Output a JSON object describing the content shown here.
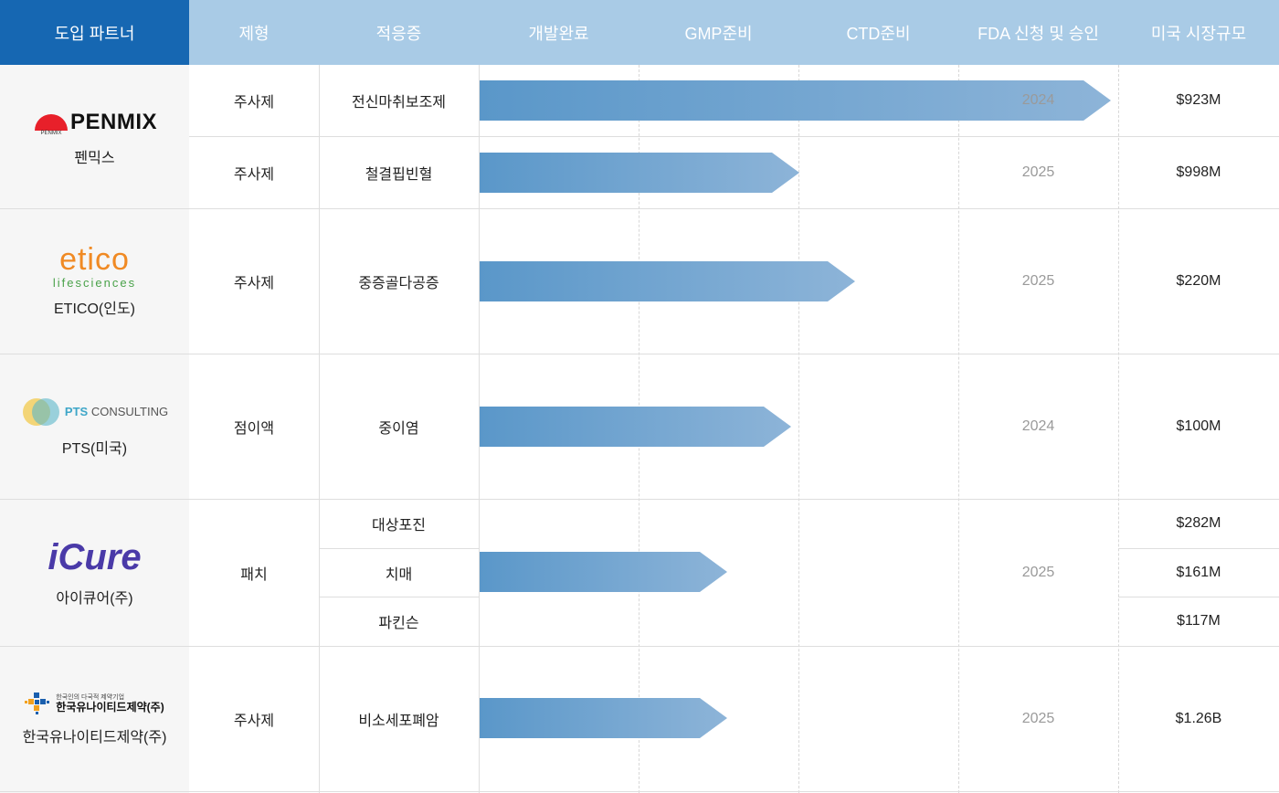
{
  "header": {
    "columns": [
      "도입 파트너",
      "제형",
      "적응증",
      "개발완료",
      "GMP준비",
      "CTD준비",
      "FDA 신청 및 승인",
      "미국 시장규모"
    ]
  },
  "partners": [
    {
      "logo_text": "PENMIX",
      "logo_small": "PENMIX",
      "name": "펜믹스"
    },
    {
      "logo_text": "etico",
      "logo_sub": "lifesciences",
      "name": "ETICO(인도)"
    },
    {
      "logo_text": "PTS",
      "logo_sub": "CONSULTING",
      "name": "PTS(미국)"
    },
    {
      "logo_text": "iCure",
      "name": "아이큐어(주)"
    },
    {
      "logo_small": "한국인의 다국적 제약기업",
      "logo_text": "한국유나이티드제약(주)",
      "name": "한국유나이티드제약(주)"
    }
  ],
  "rows": [
    {
      "form": "주사제",
      "indications": [
        "전신마취보조제"
      ],
      "year": "2024",
      "markets": [
        "$923M"
      ],
      "progress_stage": 3.95
    },
    {
      "form": "주사제",
      "indications": [
        "철결핍빈혈"
      ],
      "year": "2025",
      "markets": [
        "$998M"
      ],
      "progress_stage": 2.0
    },
    {
      "form": "주사제",
      "indications": [
        "중증골다공증"
      ],
      "year": "2025",
      "markets": [
        "$220M"
      ],
      "progress_stage": 2.35
    },
    {
      "form": "점이액",
      "indications": [
        "중이염"
      ],
      "year": "2024",
      "markets": [
        "$100M"
      ],
      "progress_stage": 1.95
    },
    {
      "form": "패치",
      "indications": [
        "대상포진",
        "치매",
        "파킨슨"
      ],
      "year": "2025",
      "markets": [
        "$282M",
        "$161M",
        "$117M"
      ],
      "progress_stage": 1.55
    },
    {
      "form": "주사제",
      "indications": [
        "비소세포폐암"
      ],
      "year": "2025",
      "markets": [
        "$1.26B"
      ],
      "progress_stage": 1.55
    }
  ],
  "colors": {
    "header_primary": "#1667b2",
    "header_secondary": "#a9cbe6",
    "bar_start": "#5a97c9",
    "bar_end": "#8db4d8"
  }
}
